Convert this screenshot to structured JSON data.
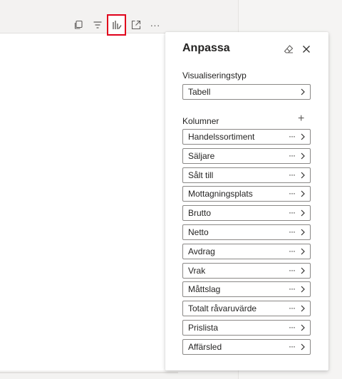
{
  "visual_header": {
    "icons": [
      "copy-icon",
      "filter-icon",
      "customize-visual-icon",
      "focus-mode-icon",
      "more-options-icon"
    ],
    "more_label": "···"
  },
  "pane": {
    "title": "Anpassa",
    "visualization_label": "Visualiseringstyp",
    "visualization_value": "Tabell",
    "columns_label": "Kolumner",
    "add_label": "+",
    "more_label": "···",
    "columns": [
      "Handelssortiment",
      "Säljare",
      "Sålt till",
      "Mottagningsplats",
      "Brutto",
      "Netto",
      "Avdrag",
      "Vrak",
      "Måttslag",
      "Totalt råvaruvärde",
      "Prislista",
      "Affärsled"
    ]
  },
  "colors": {
    "active_outline": "#e0001b",
    "border": "#8a8886",
    "text": "#252423"
  }
}
